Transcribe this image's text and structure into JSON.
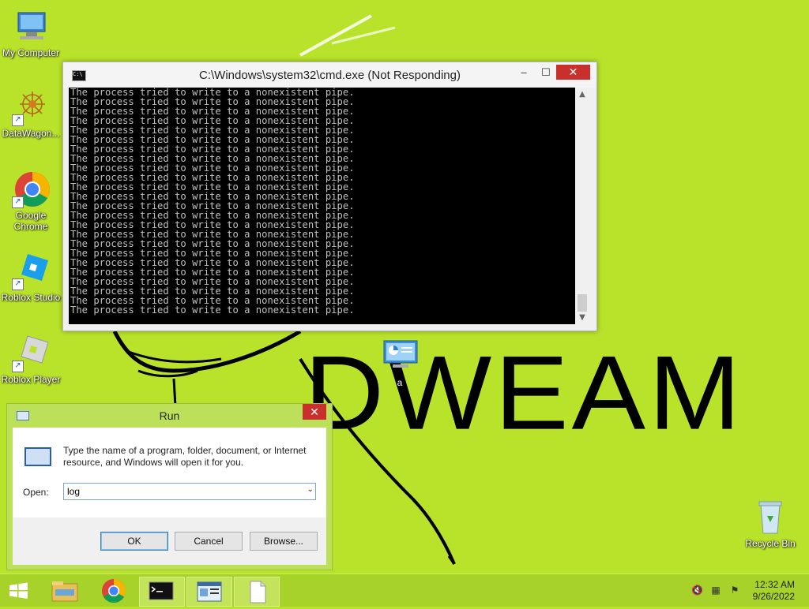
{
  "desktop": {
    "icons": [
      {
        "label": "My Computer",
        "icon": "computer-icon"
      },
      {
        "label": "DataWagon...",
        "icon": "datawagon-icon"
      },
      {
        "label": "Google Chrome",
        "icon": "chrome-icon"
      },
      {
        "label": "Roblox Studio",
        "icon": "roblox-studio-icon"
      },
      {
        "label": "Roblox Player",
        "icon": "roblox-player-icon"
      },
      {
        "label": "a",
        "icon": "control-panel-icon"
      },
      {
        "label": "Recycle Bin",
        "icon": "recycle-bin-icon"
      }
    ],
    "wallpaper_text": "DWEAM"
  },
  "cmd_window": {
    "title": "C:\\Windows\\system32\\cmd.exe (Not Responding)",
    "icon_text": "C:\\",
    "min_glyph": "–",
    "max_glyph": "☐",
    "close_glyph": "✕",
    "lines": [
      "The process tried to write to a nonexistent pipe.",
      "The process tried to write to a nonexistent pipe.",
      "The process tried to write to a nonexistent pipe.",
      "The process tried to write to a nonexistent pipe.",
      "The process tried to write to a nonexistent pipe.",
      "The process tried to write to a nonexistent pipe.",
      "The process tried to write to a nonexistent pipe.",
      "The process tried to write to a nonexistent pipe.",
      "The process tried to write to a nonexistent pipe.",
      "The process tried to write to a nonexistent pipe.",
      "The process tried to write to a nonexistent pipe.",
      "The process tried to write to a nonexistent pipe.",
      "The process tried to write to a nonexistent pipe.",
      "The process tried to write to a nonexistent pipe.",
      "The process tried to write to a nonexistent pipe.",
      "The process tried to write to a nonexistent pipe.",
      "The process tried to write to a nonexistent pipe.",
      "The process tried to write to a nonexistent pipe.",
      "The process tried to write to a nonexistent pipe.",
      "The process tried to write to a nonexistent pipe.",
      "The process tried to write to a nonexistent pipe.",
      "The process tried to write to a nonexistent pipe.",
      "The process tried to write to a nonexistent pipe.",
      "The process tried to write to a nonexistent pipe."
    ],
    "scroll_up_glyph": "▲",
    "scroll_down_glyph": "▼"
  },
  "run_dialog": {
    "title": "Run",
    "close_glyph": "✕",
    "description": "Type the name of a program, folder, document, or Internet resource, and Windows will open it for you.",
    "open_label": "Open:",
    "open_value": "log",
    "dropdown_glyph": "⌄",
    "ok_label": "OK",
    "cancel_label": "Cancel",
    "browse_label": "Browse..."
  },
  "taskbar": {
    "items": [
      {
        "name": "start",
        "icon": "windows-start-icon"
      },
      {
        "name": "file-explorer",
        "icon": "folder-icon"
      },
      {
        "name": "chrome",
        "icon": "chrome-icon"
      },
      {
        "name": "cmd",
        "icon": "cmd-icon"
      },
      {
        "name": "run",
        "icon": "run-icon"
      },
      {
        "name": "document",
        "icon": "document-icon"
      }
    ],
    "time": "12:32 AM",
    "date": "9/26/2022"
  }
}
